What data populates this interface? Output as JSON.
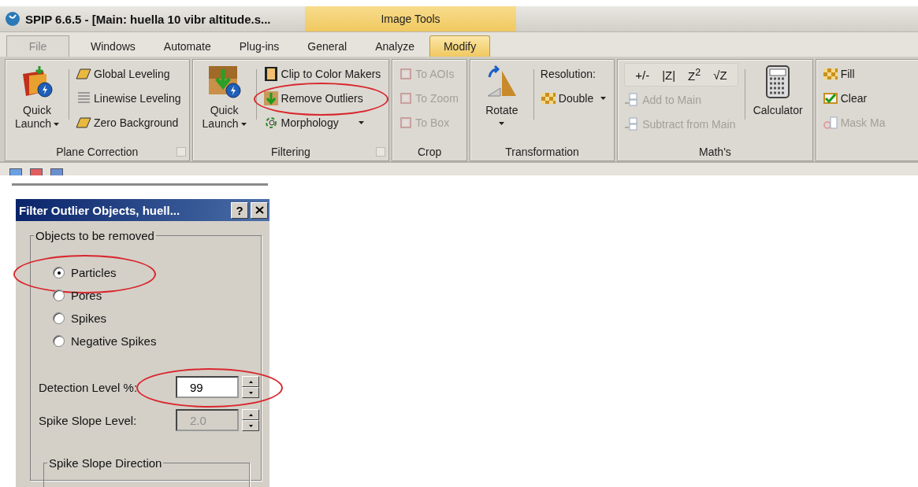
{
  "window": {
    "title": "SPIP 6.6.5 - [Main: huella 10 vibr altitude.s...",
    "context_tab": "Image Tools"
  },
  "menu_tabs": [
    {
      "label": "File",
      "selected": false,
      "kind": "file"
    },
    {
      "label": "Windows",
      "selected": false,
      "kind": "tab"
    },
    {
      "label": "Automate",
      "selected": false,
      "kind": "tab"
    },
    {
      "label": "Plug-ins",
      "selected": false,
      "kind": "tab"
    },
    {
      "label": "General",
      "selected": false,
      "kind": "tab"
    },
    {
      "label": "Analyze",
      "selected": false,
      "kind": "tab"
    },
    {
      "label": "Modify",
      "selected": true,
      "kind": "tab"
    }
  ],
  "ribbon_groups": [
    {
      "label": "Plane Correction",
      "launcher": true,
      "columns": [
        {
          "kind": "large",
          "lines": [
            "Quick",
            "Launch"
          ],
          "dropdown": true
        },
        {
          "kind": "list",
          "items": [
            {
              "kind": "item",
              "label": "Global Leveling",
              "disabled": false,
              "highlighted": false
            },
            {
              "kind": "item",
              "label": "Linewise Leveling",
              "disabled": false,
              "highlighted": false
            },
            {
              "kind": "item",
              "label": "Zero Background",
              "disabled": false,
              "highlighted": false
            }
          ]
        }
      ]
    },
    {
      "label": "Filtering",
      "launcher": true,
      "columns": [
        {
          "kind": "large",
          "lines": [
            "Quick",
            "Launch"
          ],
          "dropdown": true
        },
        {
          "kind": "list",
          "items": [
            {
              "kind": "item",
              "label": "Clip to Color Makers",
              "disabled": false,
              "highlighted": false
            },
            {
              "kind": "item",
              "label": "Remove Outliers",
              "disabled": false,
              "highlighted": true
            },
            {
              "kind": "item",
              "label": "Morphology",
              "disabled": false,
              "highlighted": false,
              "dropdown": true
            }
          ]
        }
      ]
    },
    {
      "label": "Crop",
      "columns": [
        {
          "kind": "list",
          "items": [
            {
              "kind": "item",
              "label": "To AOIs",
              "disabled": true,
              "highlighted": false
            },
            {
              "kind": "item",
              "label": "To Zoom",
              "disabled": true,
              "highlighted": false
            },
            {
              "kind": "item",
              "label": "To Box",
              "disabled": true,
              "highlighted": false
            }
          ]
        }
      ]
    },
    {
      "label": "Transformation",
      "columns": [
        {
          "kind": "large",
          "lines": [
            "Rotate"
          ],
          "dropdown": true
        },
        {
          "kind": "list",
          "items": [
            {
              "kind": "caption",
              "label": "Resolution:"
            },
            {
              "kind": "item",
              "label": "Double",
              "disabled": false,
              "highlighted": false,
              "dropdown": true
            }
          ]
        }
      ]
    },
    {
      "label": "Math's",
      "columns": [
        {
          "kind": "list",
          "items": [
            {
              "kind": "keys",
              "keys": [
                "+/-",
                "|Z|",
                "Z$^{2}$",
                "√Z"
              ]
            },
            {
              "kind": "item",
              "label": "Add to Main",
              "disabled": true,
              "highlighted": false
            },
            {
              "kind": "item",
              "label": "Subtract from Main",
              "disabled": true,
              "highlighted": false
            }
          ]
        },
        {
          "kind": "large",
          "lines": [
            "Calculator"
          ],
          "dropdown": false
        }
      ]
    },
    {
      "columns": [
        {
          "kind": "list",
          "items": [
            {
              "kind": "item",
              "label": "Fill",
              "disabled": false,
              "highlighted": false
            },
            {
              "kind": "item",
              "label": "Clear",
              "disabled": false,
              "highlighted": false
            },
            {
              "kind": "item",
              "label": "Mask Ma",
              "disabled": true,
              "highlighted": false
            }
          ]
        }
      ]
    }
  ],
  "dialog": {
    "title": "Filter Outlier Objects, huell...",
    "help": "?",
    "group_title": "Objects to be removed",
    "options": [
      {
        "label": "Particles",
        "selected": true,
        "highlighted": true
      },
      {
        "label": "Pores",
        "selected": false,
        "highlighted": false
      },
      {
        "label": "Spikes",
        "selected": false,
        "highlighted": false
      },
      {
        "label": "Negative Spikes",
        "selected": false,
        "highlighted": false
      }
    ],
    "fields": [
      {
        "label": "Detection Level %:",
        "value": "99",
        "disabled": false,
        "highlighted": true
      },
      {
        "label": "Spike Slope Level:",
        "value": "2.0",
        "disabled": true,
        "highlighted": false
      }
    ],
    "direction_group_title": "Spike Slope Direction"
  }
}
